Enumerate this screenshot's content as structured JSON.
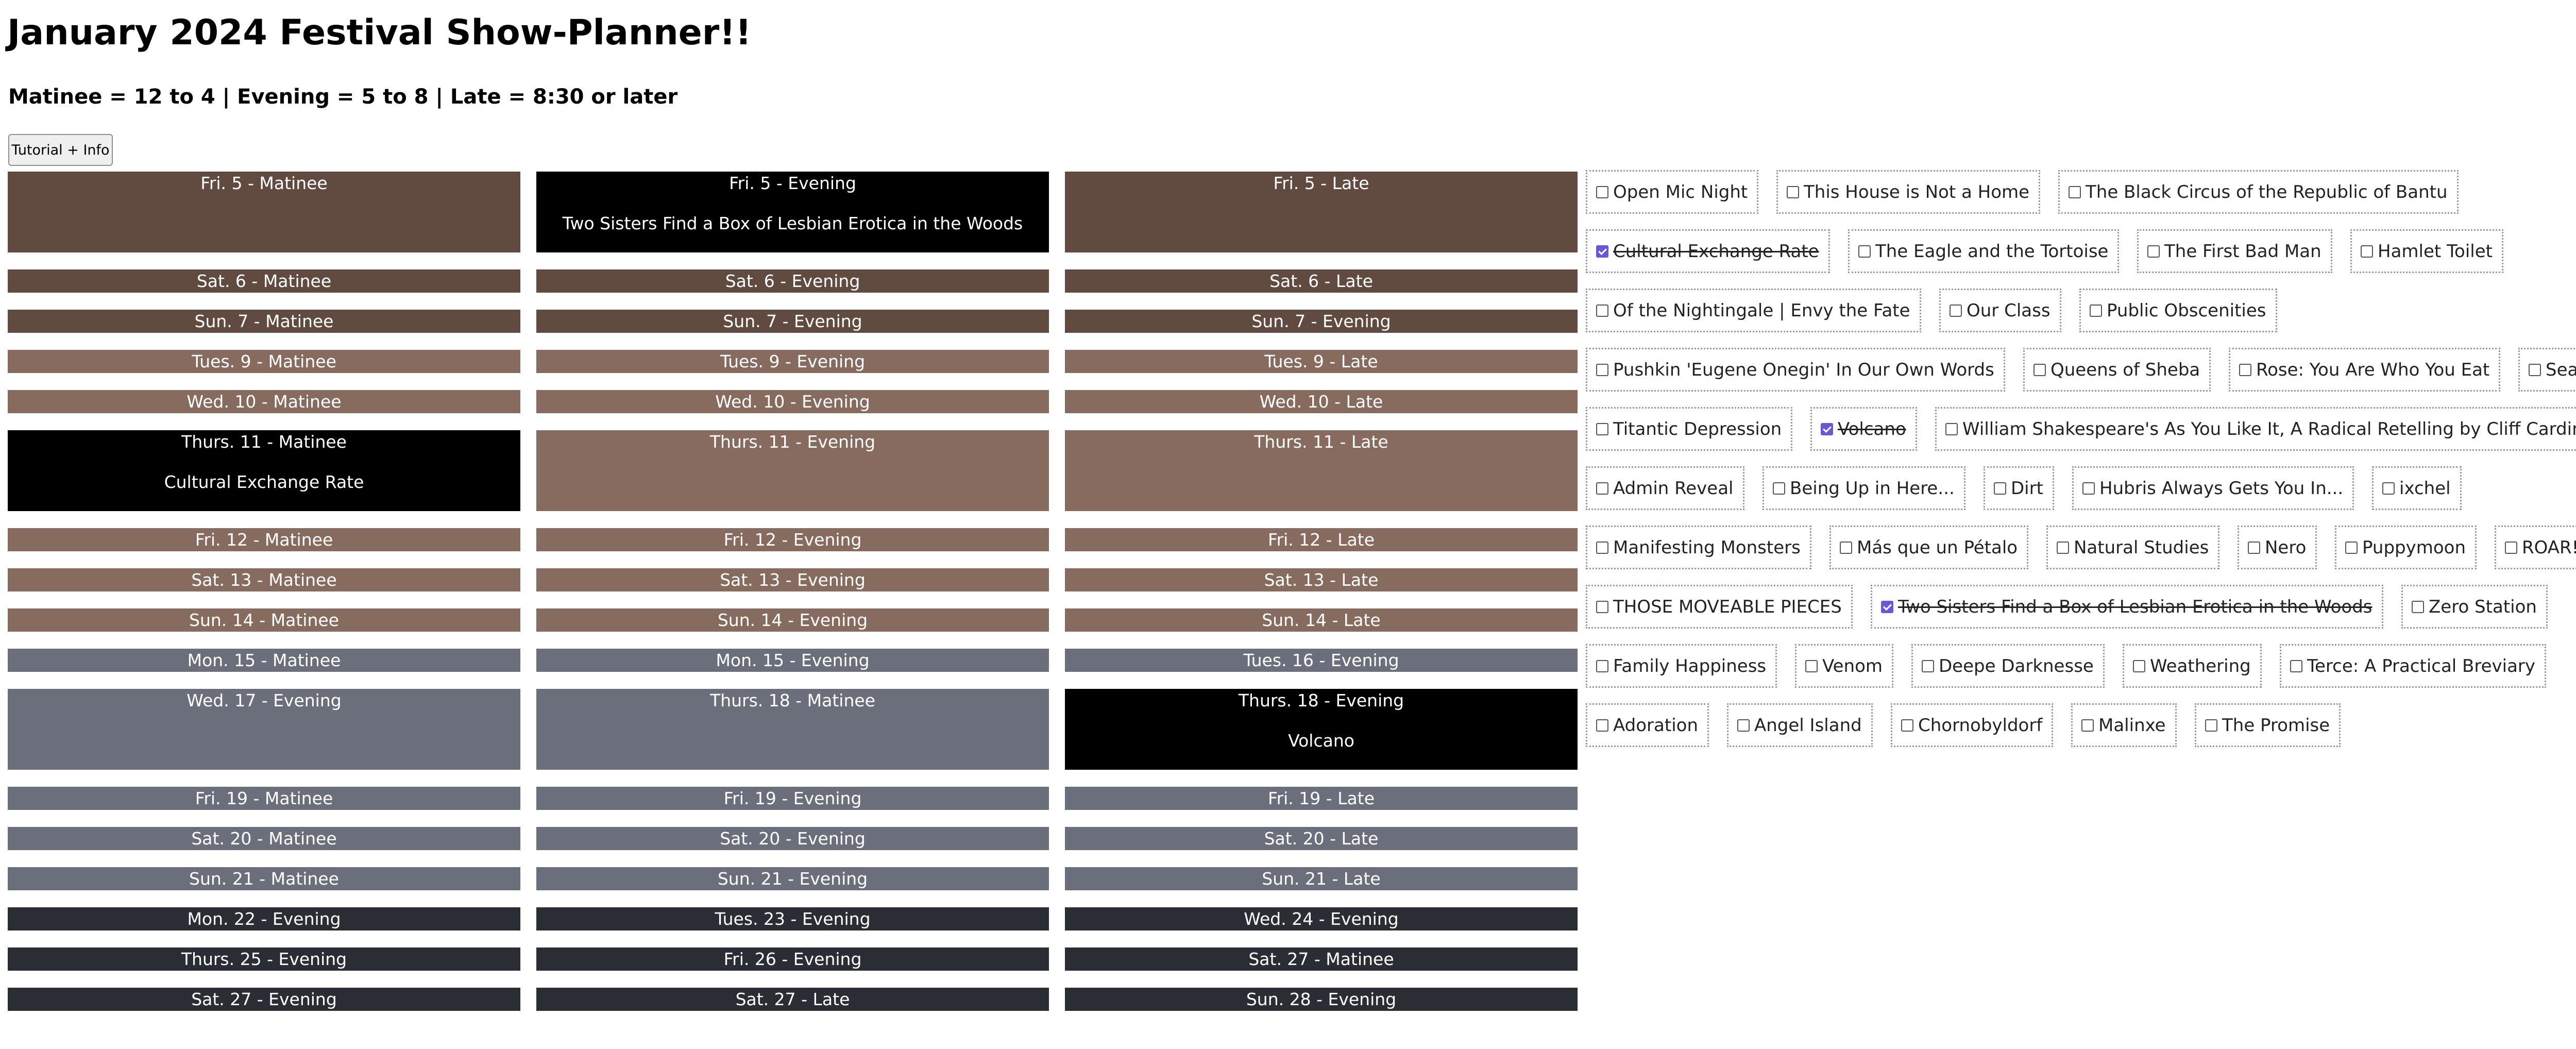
{
  "page": {
    "title": "January 2024 Festival Show-Planner!!",
    "subtitle": "Matinee = 12 to 4 | Evening = 5 to 8 | Late = 8:30 or later",
    "tutorial_label": "Tutorial + Info"
  },
  "colors": {
    "brown": "#614b40",
    "taupe": "#876b5e",
    "slate": "#6b6e7b",
    "dark": "#2a2d34",
    "selected": "#000000",
    "check": "#6b57d6"
  },
  "slots": [
    {
      "label": "Fri. 5 - Matinee",
      "color": "brown",
      "tall": true,
      "show": ""
    },
    {
      "label": "Fri. 5 - Evening",
      "color": "selected",
      "tall": true,
      "show": "Two Sisters Find a Box of Lesbian Erotica in the Woods"
    },
    {
      "label": "Fri. 5 - Late",
      "color": "brown",
      "tall": true,
      "show": ""
    },
    {
      "label": "Sat. 6 - Matinee",
      "color": "brown",
      "tall": false,
      "show": ""
    },
    {
      "label": "Sat. 6 - Evening",
      "color": "brown",
      "tall": false,
      "show": ""
    },
    {
      "label": "Sat. 6 - Late",
      "color": "brown",
      "tall": false,
      "show": ""
    },
    {
      "label": "Sun. 7 - Matinee",
      "color": "brown",
      "tall": false,
      "show": ""
    },
    {
      "label": "Sun. 7 - Evening",
      "color": "brown",
      "tall": false,
      "show": ""
    },
    {
      "label": "Sun. 7 - Evening",
      "color": "brown",
      "tall": false,
      "show": ""
    },
    {
      "label": "Tues. 9 - Matinee",
      "color": "taupe",
      "tall": false,
      "show": ""
    },
    {
      "label": "Tues. 9 - Evening",
      "color": "taupe",
      "tall": false,
      "show": ""
    },
    {
      "label": "Tues. 9 - Late",
      "color": "taupe",
      "tall": false,
      "show": ""
    },
    {
      "label": "Wed. 10 - Matinee",
      "color": "taupe",
      "tall": false,
      "show": ""
    },
    {
      "label": "Wed. 10 - Evening",
      "color": "taupe",
      "tall": false,
      "show": ""
    },
    {
      "label": "Wed. 10 - Late",
      "color": "taupe",
      "tall": false,
      "show": ""
    },
    {
      "label": "Thurs. 11 - Matinee",
      "color": "selected",
      "tall": true,
      "show": "Cultural Exchange Rate"
    },
    {
      "label": "Thurs. 11 - Evening",
      "color": "taupe",
      "tall": true,
      "show": ""
    },
    {
      "label": "Thurs. 11 - Late",
      "color": "taupe",
      "tall": true,
      "show": ""
    },
    {
      "label": "Fri. 12 - Matinee",
      "color": "taupe",
      "tall": false,
      "show": ""
    },
    {
      "label": "Fri. 12 - Evening",
      "color": "taupe",
      "tall": false,
      "show": ""
    },
    {
      "label": "Fri. 12 - Late",
      "color": "taupe",
      "tall": false,
      "show": ""
    },
    {
      "label": "Sat. 13 - Matinee",
      "color": "taupe",
      "tall": false,
      "show": ""
    },
    {
      "label": "Sat. 13 - Evening",
      "color": "taupe",
      "tall": false,
      "show": ""
    },
    {
      "label": "Sat. 13 - Late",
      "color": "taupe",
      "tall": false,
      "show": ""
    },
    {
      "label": "Sun. 14 - Matinee",
      "color": "taupe",
      "tall": false,
      "show": ""
    },
    {
      "label": "Sun. 14 - Evening",
      "color": "taupe",
      "tall": false,
      "show": ""
    },
    {
      "label": "Sun. 14 - Late",
      "color": "taupe",
      "tall": false,
      "show": ""
    },
    {
      "label": "Mon. 15 - Matinee",
      "color": "slate",
      "tall": false,
      "show": ""
    },
    {
      "label": "Mon. 15 - Evening",
      "color": "slate",
      "tall": false,
      "show": ""
    },
    {
      "label": "Tues. 16 - Evening",
      "color": "slate",
      "tall": false,
      "show": ""
    },
    {
      "label": "Wed. 17 - Evening",
      "color": "slate",
      "tall": true,
      "show": ""
    },
    {
      "label": "Thurs. 18 - Matinee",
      "color": "slate",
      "tall": true,
      "show": ""
    },
    {
      "label": "Thurs. 18 - Evening",
      "color": "selected",
      "tall": true,
      "show": "Volcano"
    },
    {
      "label": "Fri. 19 - Matinee",
      "color": "slate",
      "tall": false,
      "show": ""
    },
    {
      "label": "Fri. 19 - Evening",
      "color": "slate",
      "tall": false,
      "show": ""
    },
    {
      "label": "Fri. 19 - Late",
      "color": "slate",
      "tall": false,
      "show": ""
    },
    {
      "label": "Sat. 20 - Matinee",
      "color": "slate",
      "tall": false,
      "show": ""
    },
    {
      "label": "Sat. 20 - Evening",
      "color": "slate",
      "tall": false,
      "show": ""
    },
    {
      "label": "Sat. 20 - Late",
      "color": "slate",
      "tall": false,
      "show": ""
    },
    {
      "label": "Sun. 21 - Matinee",
      "color": "slate",
      "tall": false,
      "show": ""
    },
    {
      "label": "Sun. 21 - Evening",
      "color": "slate",
      "tall": false,
      "show": ""
    },
    {
      "label": "Sun. 21 - Late",
      "color": "slate",
      "tall": false,
      "show": ""
    },
    {
      "label": "Mon. 22 - Evening",
      "color": "dark",
      "tall": false,
      "show": ""
    },
    {
      "label": "Tues. 23 - Evening",
      "color": "dark",
      "tall": false,
      "show": ""
    },
    {
      "label": "Wed. 24 - Evening",
      "color": "dark",
      "tall": false,
      "show": ""
    },
    {
      "label": "Thurs. 25 - Evening",
      "color": "dark",
      "tall": false,
      "show": ""
    },
    {
      "label": "Fri. 26 - Evening",
      "color": "dark",
      "tall": false,
      "show": ""
    },
    {
      "label": "Sat. 27 - Matinee",
      "color": "dark",
      "tall": false,
      "show": ""
    },
    {
      "label": "Sat. 27 - Evening",
      "color": "dark",
      "tall": false,
      "show": ""
    },
    {
      "label": "Sat. 27 - Late",
      "color": "dark",
      "tall": false,
      "show": ""
    },
    {
      "label": "Sun. 28 - Evening",
      "color": "dark",
      "tall": false,
      "show": ""
    }
  ],
  "show_rows": [
    [
      {
        "label": "Open Mic Night",
        "checked": false
      },
      {
        "label": "This House is Not a Home",
        "checked": false
      },
      {
        "label": "The Black Circus of the Republic of Bantu",
        "checked": false
      }
    ],
    [
      {
        "label": "Cultural Exchange Rate",
        "checked": true
      },
      {
        "label": "The Eagle and the Tortoise",
        "checked": false
      },
      {
        "label": "The First Bad Man",
        "checked": false
      },
      {
        "label": "Hamlet Toilet",
        "checked": false
      }
    ],
    [
      {
        "label": "Of the Nightingale | Envy the Fate",
        "checked": false
      },
      {
        "label": "Our Class",
        "checked": false
      },
      {
        "label": "Public Obscenities",
        "checked": false
      }
    ],
    [
      {
        "label": "Pushkin 'Eugene Onegin' In Our Own Words",
        "checked": false
      },
      {
        "label": "Queens of Sheba",
        "checked": false
      },
      {
        "label": "Rose: You Are Who You Eat",
        "checked": false
      },
      {
        "label": "Search Party",
        "checked": false
      }
    ],
    [
      {
        "label": "Titantic Depression",
        "checked": false
      },
      {
        "label": "Volcano",
        "checked": true
      },
      {
        "label": "William Shakespeare's As You Like It, A Radical Retelling by Cliff Cardinal",
        "checked": false
      }
    ],
    [
      {
        "label": "Admin Reveal",
        "checked": false
      },
      {
        "label": "Being Up in Here...",
        "checked": false
      },
      {
        "label": "Dirt",
        "checked": false
      },
      {
        "label": "Hubris Always Gets You In...",
        "checked": false
      },
      {
        "label": "ixchel",
        "checked": false
      }
    ],
    [
      {
        "label": "Manifesting Monsters",
        "checked": false
      },
      {
        "label": "Más que un Pétalo",
        "checked": false
      },
      {
        "label": "Natural Studies",
        "checked": false
      },
      {
        "label": "Nero",
        "checked": false
      },
      {
        "label": "Puppymoon",
        "checked": false
      },
      {
        "label": "ROAR!",
        "checked": false
      }
    ],
    [
      {
        "label": "THOSE MOVEABLE PIECES",
        "checked": false
      },
      {
        "label": "Two Sisters Find a Box of Lesbian Erotica in the Woods",
        "checked": true
      },
      {
        "label": "Zero Station",
        "checked": false
      }
    ],
    [
      {
        "label": "Family Happiness",
        "checked": false
      },
      {
        "label": "Venom",
        "checked": false
      },
      {
        "label": "Deepe Darknesse",
        "checked": false
      },
      {
        "label": "Weathering",
        "checked": false
      },
      {
        "label": "Terce: A Practical Breviary",
        "checked": false
      }
    ],
    [
      {
        "label": "Adoration",
        "checked": false
      },
      {
        "label": "Angel Island",
        "checked": false
      },
      {
        "label": "Chornobyldorf",
        "checked": false
      },
      {
        "label": "Malinxe",
        "checked": false
      },
      {
        "label": "The Promise",
        "checked": false
      }
    ]
  ]
}
